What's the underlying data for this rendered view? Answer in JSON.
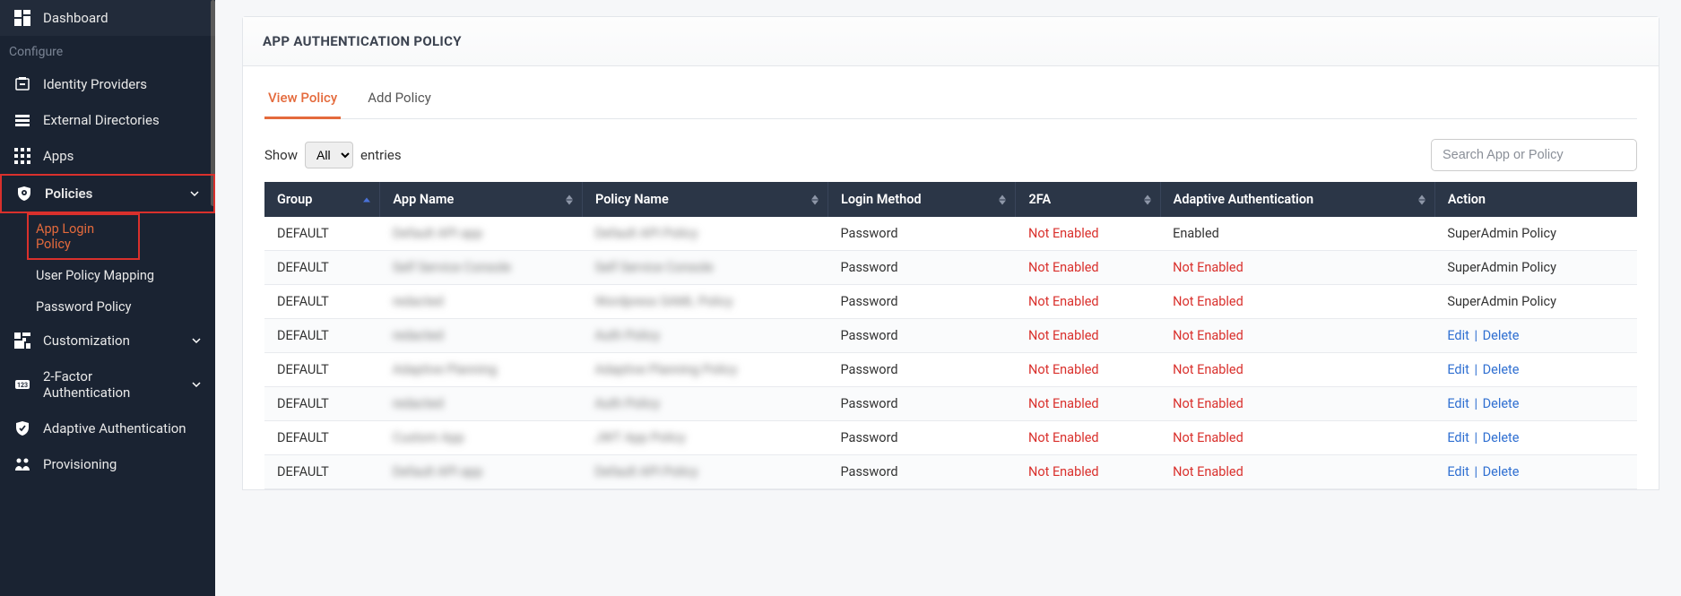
{
  "sidebar": {
    "items": [
      {
        "label": "Dashboard"
      }
    ],
    "section_label": "Configure",
    "configure_items": [
      {
        "label": "Identity Providers"
      },
      {
        "label": "External Directories"
      },
      {
        "label": "Apps"
      },
      {
        "label": "Policies",
        "expanded": true,
        "highlighted": true
      },
      {
        "label": "Customization",
        "expandable": true
      },
      {
        "label": "2-Factor Authentication",
        "expandable": true
      },
      {
        "label": "Adaptive Authentication"
      },
      {
        "label": "Provisioning"
      }
    ],
    "policies_subitems": [
      {
        "label": "App Login Policy",
        "active": true
      },
      {
        "label": "User Policy Mapping"
      },
      {
        "label": "Password Policy"
      }
    ]
  },
  "panel": {
    "title": "APP AUTHENTICATION POLICY"
  },
  "tabs": [
    {
      "label": "View Policy",
      "active": true
    },
    {
      "label": "Add Policy"
    }
  ],
  "list_controls": {
    "show_label": "Show",
    "entries_label": "entries",
    "select_value": "All",
    "search_placeholder": "Search App or Policy"
  },
  "columns": [
    {
      "label": "Group",
      "sorted": "asc"
    },
    {
      "label": "App Name"
    },
    {
      "label": "Policy Name"
    },
    {
      "label": "Login Method"
    },
    {
      "label": "2FA"
    },
    {
      "label": "Adaptive Authentication"
    },
    {
      "label": "Action"
    }
  ],
  "rows": [
    {
      "group": "DEFAULT",
      "app": "Default API app",
      "policy": "Default API Policy",
      "login": "Password",
      "twofa": "Not Enabled",
      "adaptive": "Enabled",
      "action_type": "text",
      "action_text": "SuperAdmin Policy"
    },
    {
      "group": "DEFAULT",
      "app": "Self Service Console",
      "policy": "Self Service Console",
      "login": "Password",
      "twofa": "Not Enabled",
      "adaptive": "Not Enabled",
      "action_type": "text",
      "action_text": "SuperAdmin Policy"
    },
    {
      "group": "DEFAULT",
      "app": "redacted",
      "policy": "Wordpress SAML Policy",
      "login": "Password",
      "twofa": "Not Enabled",
      "adaptive": "Not Enabled",
      "action_type": "text",
      "action_text": "SuperAdmin Policy"
    },
    {
      "group": "DEFAULT",
      "app": "redacted",
      "policy": "Auth Policy",
      "login": "Password",
      "twofa": "Not Enabled",
      "adaptive": "Not Enabled",
      "action_type": "links"
    },
    {
      "group": "DEFAULT",
      "app": "Adaptive Planning",
      "policy": "Adaptive Planning Policy",
      "login": "Password",
      "twofa": "Not Enabled",
      "adaptive": "Not Enabled",
      "action_type": "links"
    },
    {
      "group": "DEFAULT",
      "app": "redacted",
      "policy": "Auth Policy",
      "login": "Password",
      "twofa": "Not Enabled",
      "adaptive": "Not Enabled",
      "action_type": "links"
    },
    {
      "group": "DEFAULT",
      "app": "Custom App",
      "policy": "JWT App Policy",
      "login": "Password",
      "twofa": "Not Enabled",
      "adaptive": "Not Enabled",
      "action_type": "links"
    },
    {
      "group": "DEFAULT",
      "app": "Default API app",
      "policy": "Default API Policy",
      "login": "Password",
      "twofa": "Not Enabled",
      "adaptive": "Not Enabled",
      "action_type": "links"
    }
  ],
  "action_labels": {
    "edit": "Edit",
    "delete": "Delete"
  }
}
